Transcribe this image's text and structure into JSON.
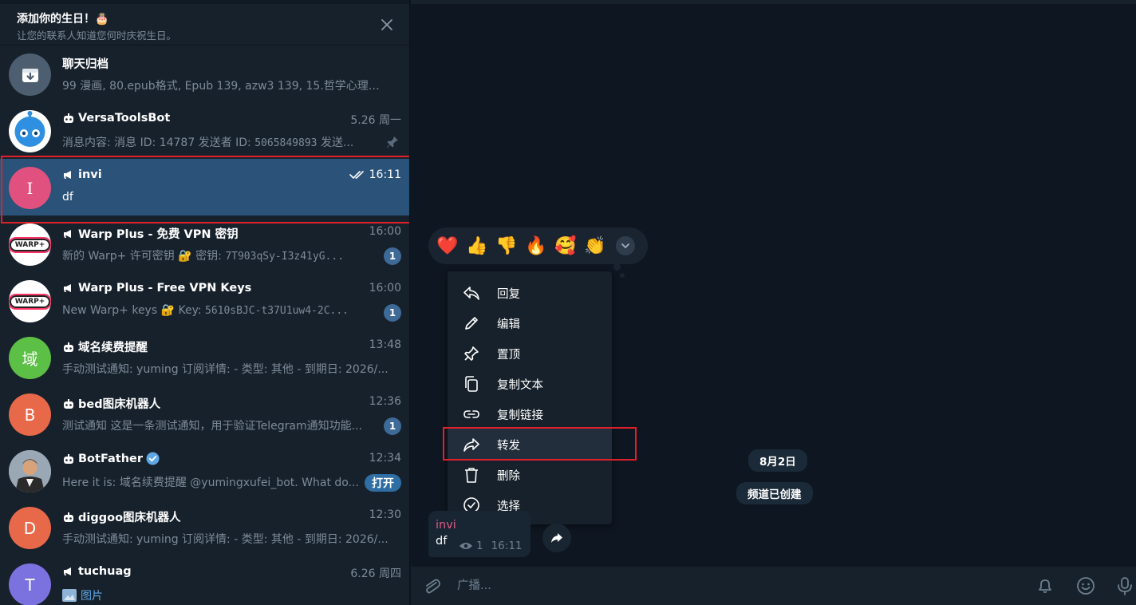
{
  "birthday_banner": {
    "title": "添加你的生日！🎂",
    "subtitle": "让您的联系人知道您何时庆祝生日。"
  },
  "chats": [
    {
      "name": "聊天归档",
      "time": "",
      "preview": "99 漫画, 80.epub格式, Epub 139, azw3 139, 15.哲学心理学...",
      "avatar_text": "",
      "avatar_color": "#4d5e70",
      "type_icon": "none"
    },
    {
      "name": "VersaToolsBot",
      "time": "5.26 周一",
      "preview_a": "消息内容: 消息 ID: 14787  发送者 ID: ",
      "preview_mono": "5065849893",
      "preview_b": " 发送...",
      "avatar_text": "",
      "avatar_color": "#ffffff",
      "type_icon": "bot",
      "pinned": true
    },
    {
      "name": "invi",
      "time": "16:11",
      "preview": "df",
      "avatar_text": "I",
      "avatar_color": "#e1517f",
      "type_icon": "channel",
      "read": true
    },
    {
      "name": "Warp Plus - 免费 VPN 密钥",
      "time": "16:00",
      "preview_a": "新的 Warp+ 许可密钥 🔐 密钥: ",
      "preview_mono": "7T903qSy-I3z41yG...",
      "avatar_text": "WARP+",
      "avatar_color": "#ffffff",
      "type_icon": "channel",
      "badge": "1"
    },
    {
      "name": "Warp Plus - Free VPN Keys",
      "time": "16:00",
      "preview_a": "New Warp+ keys 🔐 Key: ",
      "preview_mono": "5610sBJC-t37U1uw4-2C...",
      "avatar_text": "WARP+",
      "avatar_color": "#ffffff",
      "type_icon": "channel",
      "badge": "1"
    },
    {
      "name": "域名续费提醒",
      "time": "13:48",
      "preview": "手动测试通知: yuming  订阅详情: - 类型: 其他 - 到期日: 2026/...",
      "avatar_text": "域",
      "avatar_color": "#5cbf46",
      "type_icon": "bot"
    },
    {
      "name": "bed图床机器人",
      "time": "12:36",
      "preview": "测试通知  这是一条测试通知，用于验证Telegram通知功能...",
      "avatar_text": "B",
      "avatar_color": "#e8684a",
      "type_icon": "bot",
      "badge": "1"
    },
    {
      "name": "BotFather",
      "time": "12:34",
      "preview": "Here it is: 域名续费提醒 @yumingxufei_bot. What do...",
      "avatar_text": "",
      "avatar_color": "#c7cbd0",
      "type_icon": "bot",
      "verified": true,
      "action": "打开"
    },
    {
      "name": "diggoo图床机器人",
      "time": "12:30",
      "preview": "手动测试通知: yuming  订阅详情: - 类型: 其他 - 到期日: 2026/...",
      "avatar_text": "D",
      "avatar_color": "#e8684a",
      "type_icon": "bot"
    },
    {
      "name": "tuchuag",
      "time": "6.26 周四",
      "preview": "图片",
      "avatar_text": "T",
      "avatar_color": "#7b72e0",
      "type_icon": "channel"
    }
  ],
  "reactions": [
    "❤️",
    "👍",
    "👎",
    "🔥",
    "🥰",
    "👏"
  ],
  "context_menu": [
    "回复",
    "编辑",
    "置顶",
    "复制文本",
    "复制链接",
    "转发",
    "删除",
    "选择"
  ],
  "service_date": "8月2日",
  "service_created": "频道已创建",
  "message": {
    "author": "invi",
    "text": "df",
    "views": "1",
    "time": "16:11"
  },
  "composer": {
    "placeholder": "广播..."
  }
}
